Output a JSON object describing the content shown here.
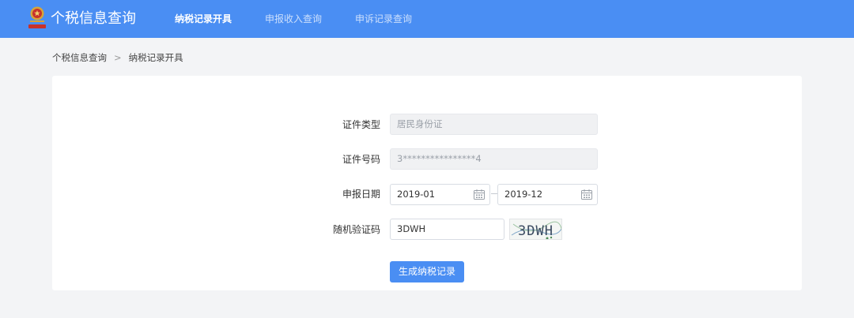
{
  "header": {
    "app_title": "个税信息查询",
    "logo_icon": "tax-emblem-icon",
    "nav": [
      {
        "label": "纳税记录开具",
        "active": true
      },
      {
        "label": "申报收入查询",
        "active": false
      },
      {
        "label": "申诉记录查询",
        "active": false
      }
    ]
  },
  "breadcrumb": {
    "items": [
      "个税信息查询",
      "纳税记录开具"
    ],
    "separator": ">"
  },
  "form": {
    "id_type": {
      "label": "证件类型",
      "value": "居民身份证"
    },
    "id_number": {
      "label": "证件号码",
      "value": "3****************4"
    },
    "declare_date": {
      "label": "申报日期",
      "start": "2019-01",
      "end": "2019-12",
      "icon": "calendar-icon"
    },
    "captcha": {
      "label": "随机验证码",
      "value": "3DWH",
      "image_text": "3DWH"
    },
    "submit_label": "生成纳税记录"
  },
  "colors": {
    "primary": "#4a8ef3",
    "page_bg": "#f3f4f6",
    "disabled_bg": "#f0f1f3"
  }
}
